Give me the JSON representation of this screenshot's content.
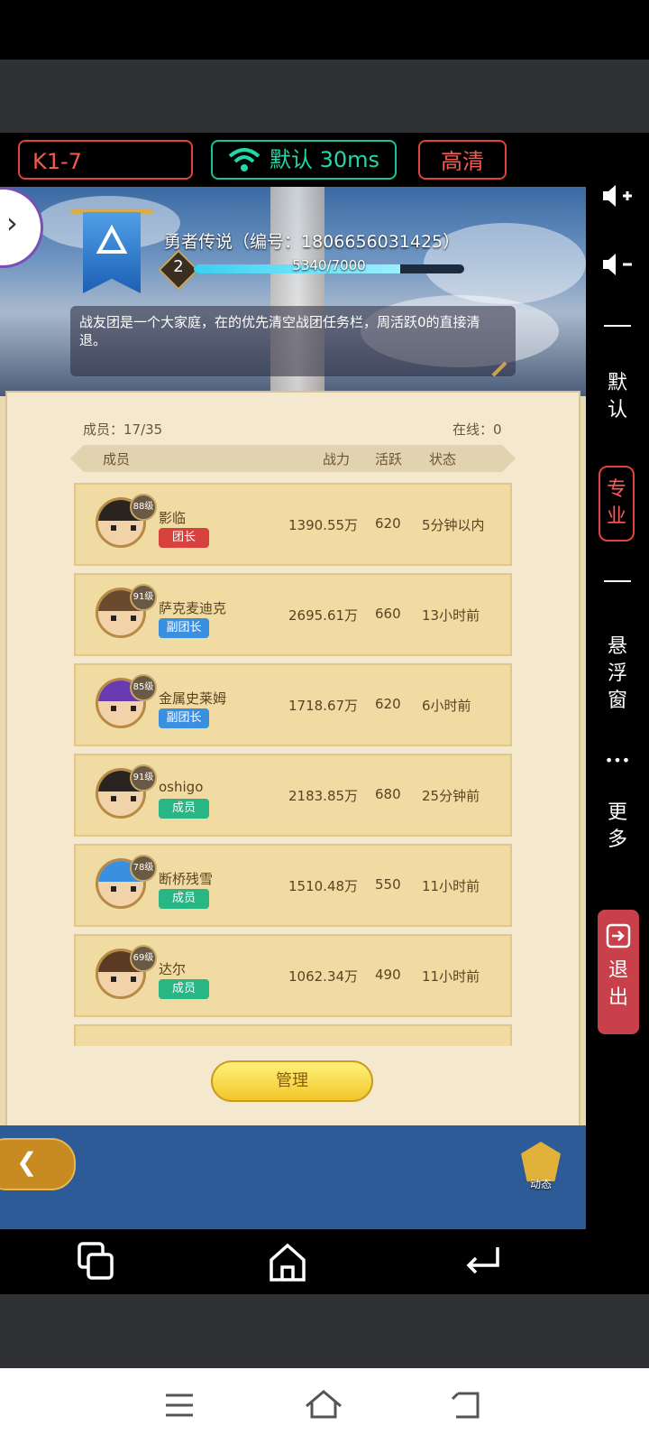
{
  "toolbar": {
    "server": "K1-7",
    "network": "默认 30ms",
    "quality": "高清"
  },
  "side_panel": {
    "vol_up": "volume-up-icon",
    "vol_down": "volume-down-icon",
    "default_label": "默\n认",
    "pro_label": "专\n业",
    "float_label": "悬\n浮\n窗",
    "more_dots": "•••",
    "more_label": "更\n多",
    "exit_label": "退\n出"
  },
  "guild": {
    "name": "勇者传说（编号：1806656031425）",
    "level": "2",
    "xp_text": "5340/7000",
    "xp_fraction": 0.763,
    "notice": "战友团是一个大家庭，在的优先清空战团任务栏，周活跃0的直接清退。",
    "members_count": "成员：17/35",
    "online": "在线：0"
  },
  "columns": {
    "member": "成员",
    "power": "战力",
    "activity": "活跃",
    "status": "状态"
  },
  "members": [
    {
      "level": "88级",
      "name": "影临",
      "role": "团长",
      "power": "1390.55万",
      "activity": "620",
      "status": "5分钟以内"
    },
    {
      "level": "91级",
      "name": "萨克麦迪克",
      "role": "副团长",
      "power": "2695.61万",
      "activity": "660",
      "status": "13小时前"
    },
    {
      "level": "85级",
      "name": "金属史莱姆",
      "role": "副团长",
      "power": "1718.67万",
      "activity": "620",
      "status": "6小时前"
    },
    {
      "level": "91级",
      "name": "oshigo",
      "role": "成员",
      "power": "2183.85万",
      "activity": "680",
      "status": "25分钟前"
    },
    {
      "level": "78级",
      "name": "断桥残雪",
      "role": "成员",
      "power": "1510.48万",
      "activity": "550",
      "status": "11小时前"
    },
    {
      "level": "69级",
      "name": "达尔",
      "role": "成员",
      "power": "1062.34万",
      "activity": "490",
      "status": "11小时前"
    }
  ],
  "buttons": {
    "manage": "管理",
    "trends": "动态"
  },
  "colors": {
    "accent_red": "#e0423c",
    "network_green": "#19c39a",
    "role_leader": "#d8423e",
    "role_deputy": "#3a8fe0",
    "role_member": "#27b684"
  }
}
